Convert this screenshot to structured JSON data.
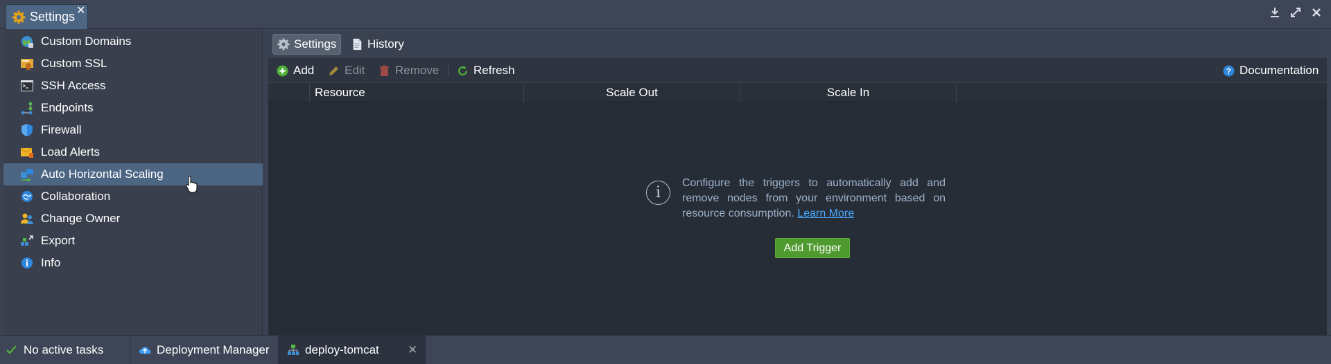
{
  "window": {
    "tab_title": "Settings",
    "close_glyph": "✕",
    "controls": [
      "download-icon",
      "expand-icon",
      "close-icon"
    ]
  },
  "sidebar": {
    "selected": "Auto Horizontal Scaling",
    "items": [
      {
        "label": "Custom Domains",
        "icon": "globe-icon"
      },
      {
        "label": "Custom SSL",
        "icon": "ssl-certificate-icon"
      },
      {
        "label": "SSH Access",
        "icon": "terminal-icon"
      },
      {
        "label": "Endpoints",
        "icon": "endpoints-icon"
      },
      {
        "label": "Firewall",
        "icon": "shield-icon"
      },
      {
        "label": "Load Alerts",
        "icon": "mail-alert-icon"
      },
      {
        "label": "Auto Horizontal Scaling",
        "icon": "scaling-icon"
      },
      {
        "label": "Collaboration",
        "icon": "handshake-icon"
      },
      {
        "label": "Change Owner",
        "icon": "users-icon"
      },
      {
        "label": "Export",
        "icon": "export-icon"
      },
      {
        "label": "Info",
        "icon": "info-icon"
      }
    ]
  },
  "subtabs": {
    "settings": "Settings",
    "history": "History"
  },
  "toolbar": {
    "add": "Add",
    "edit": "Edit",
    "remove": "Remove",
    "refresh": "Refresh",
    "documentation": "Documentation"
  },
  "grid": {
    "columns": [
      "Resource",
      "Scale Out",
      "Scale In"
    ]
  },
  "empty_state": {
    "message": "Configure the triggers to automatically add and remove nodes from your environment based on resource consumption.",
    "link": "Learn More",
    "button": "Add Trigger"
  },
  "taskbar": {
    "status": "No active tasks",
    "deployment_manager": "Deployment Manager",
    "env_tab": "deploy-tomcat",
    "close_glyph": "✕"
  },
  "colors": {
    "accent_selected": "#4b6583",
    "add_trigger_green": "#4f9a2e",
    "link_blue": "#4aa9ff"
  }
}
